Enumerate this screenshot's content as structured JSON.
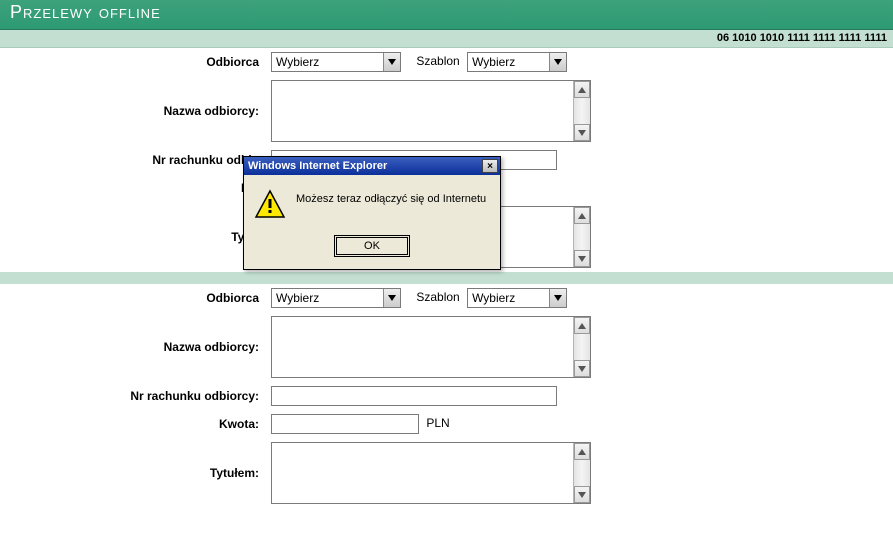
{
  "header": {
    "title": "Przelewy offline"
  },
  "account_number": "06 1010 1010 1111 1111 1111 1111",
  "labels": {
    "odbiorca": "Odbiorca",
    "nazwa_odbiorcy": "Nazwa odbiorcy:",
    "nr_rachunku": "Nr rachunku odbiorcy:",
    "nr_rachunku_cut": "Nr rachunku odbio",
    "kwota": "Kwota:",
    "kwota_cut": "Kw",
    "tytulem": "Tytułem:",
    "tytulem_cut": "Tytuł",
    "szablon": "Szablon",
    "currency": "PLN"
  },
  "dropdowns": {
    "odbiorca_selected": "Wybierz",
    "szablon_selected": "Wybierz"
  },
  "fields": {
    "nazwa_odbiorcy_1": "",
    "nr_rachunku_1": "",
    "kwota_1": "",
    "tytulem_1": "",
    "nazwa_odbiorcy_2": "",
    "nr_rachunku_2": "",
    "kwota_2": "",
    "tytulem_2": ""
  },
  "dialog": {
    "title": "Windows Internet Explorer",
    "message": "Możesz teraz odłączyć się od Internetu",
    "ok": "OK",
    "close": "×"
  }
}
